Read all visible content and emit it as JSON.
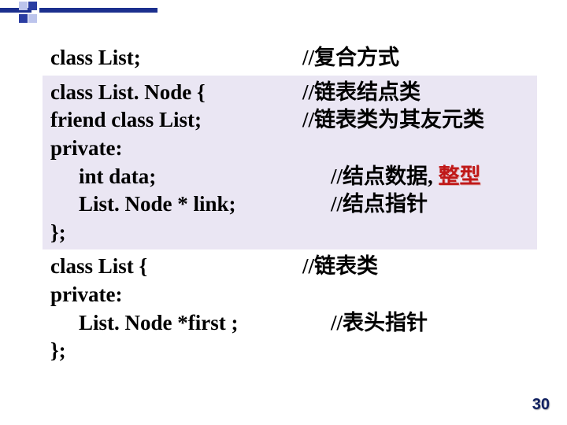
{
  "block1": {
    "l1_left": "class List;",
    "l1_right": "//复合方式"
  },
  "block2": {
    "l1_left": "class List. Node {",
    "l1_right": "//链表结点类",
    "l2_left": "friend class List;",
    "l2_right": "//链表类为其友元类",
    "l3_left": "private:",
    "l4_left": "int data;",
    "l4_right_a": "//结点数据, ",
    "l4_right_b": "整型",
    "l5_left": "List. Node * link;",
    "l5_right": "//结点指针",
    "l6_left": "};"
  },
  "block3": {
    "l1_left": "class List {",
    "l1_right": "//链表类",
    "l2_left": "private:",
    "l3_left": "List. Node *first ;",
    "l3_right": "//表头指针",
    "l4_left": "};"
  },
  "page_number": "30"
}
